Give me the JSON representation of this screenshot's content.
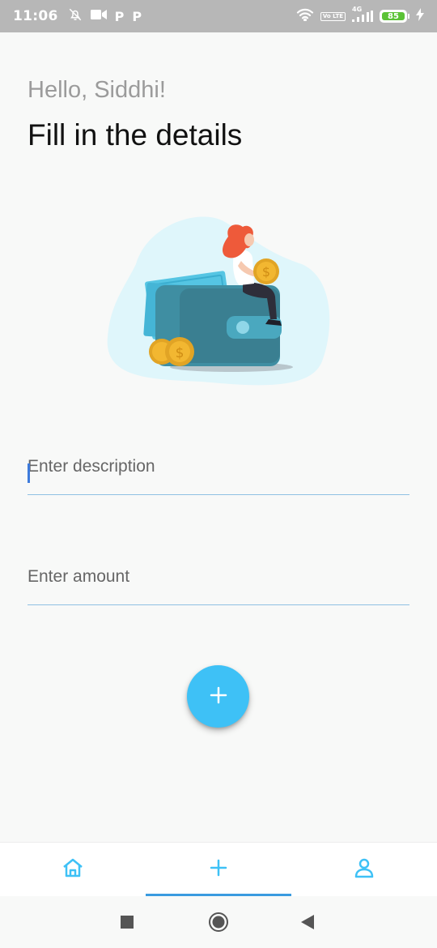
{
  "status_bar": {
    "time": "11:06",
    "left_icons": [
      "bell-off-icon",
      "video-icon",
      "p-icon",
      "p-icon"
    ],
    "p_label": "P",
    "right_icons": [
      "wifi-icon",
      "volte-icon",
      "signal-4g-icon",
      "battery-icon",
      "charging-icon"
    ],
    "volte_label": "Vo LTE",
    "network_label": "4G",
    "battery_level": "85",
    "battery_color": "#5bc236"
  },
  "header": {
    "greeting": "Hello, Siddhi!",
    "title": "Fill in the details"
  },
  "illustration": {
    "name": "wallet-girl-illustration",
    "blob_color": "#dff6fb",
    "wallet_color": "#3f8ea2",
    "coin_color": "#f2b731"
  },
  "form": {
    "description": {
      "placeholder": "Enter description",
      "value": ""
    },
    "amount": {
      "placeholder": "Enter amount",
      "value": ""
    }
  },
  "fab": {
    "icon": "plus-icon",
    "color": "#3ec1f6"
  },
  "bottom_nav": {
    "items": [
      {
        "name": "home",
        "icon": "home-icon",
        "active": false
      },
      {
        "name": "add",
        "icon": "plus-icon",
        "active": true
      },
      {
        "name": "profile",
        "icon": "user-icon",
        "active": false
      }
    ],
    "accent": "#3ec1f6"
  },
  "system_nav": {
    "buttons": [
      "recent-apps",
      "home",
      "back"
    ]
  }
}
